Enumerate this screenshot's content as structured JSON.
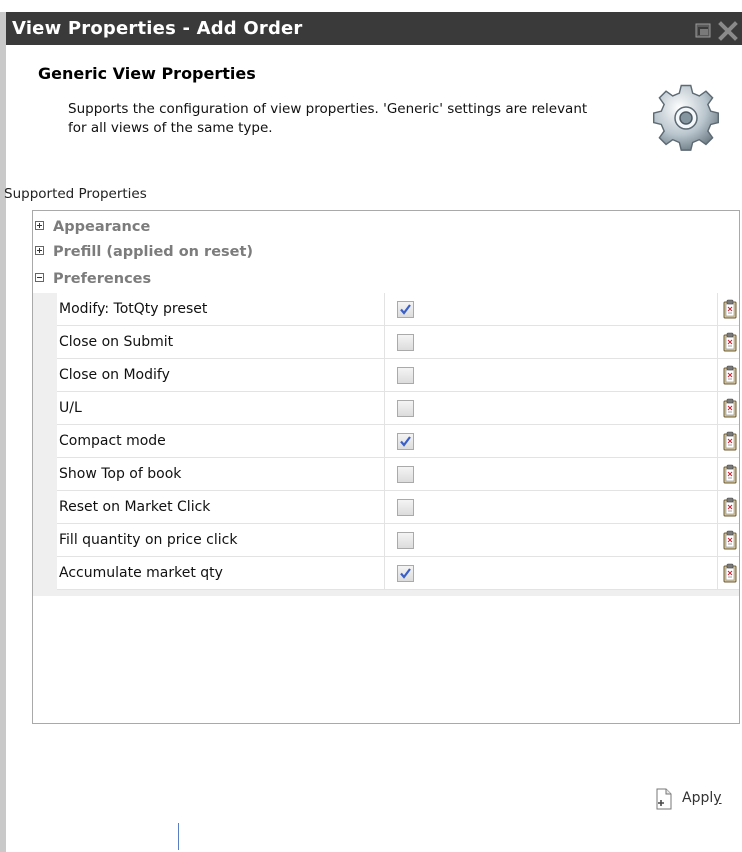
{
  "window": {
    "title": "View Properties - Add Order"
  },
  "header": {
    "title": "Generic View Properties",
    "description": "Supports the configuration of view properties. 'Generic' settings are relevant for all views of the same type."
  },
  "supported_label": "Supported Properties",
  "groups": [
    {
      "label": "Appearance",
      "expanded": false
    },
    {
      "label": "Prefill (applied on reset)",
      "expanded": false
    },
    {
      "label": "Preferences",
      "expanded": true
    }
  ],
  "preferences": [
    {
      "name": "Modify: TotQty preset",
      "checked": true
    },
    {
      "name": "Close on Submit",
      "checked": false
    },
    {
      "name": "Close on Modify",
      "checked": false
    },
    {
      "name": "U/L",
      "checked": false
    },
    {
      "name": "Compact mode",
      "checked": true
    },
    {
      "name": "Show Top of book",
      "checked": false
    },
    {
      "name": "Reset on Market Click",
      "checked": false
    },
    {
      "name": "Fill quantity on price click",
      "checked": false
    },
    {
      "name": "Accumulate market qty",
      "checked": true
    }
  ],
  "apply": {
    "label": "Apply",
    "mnemonic": "y"
  },
  "colors": {
    "titlebar": "#3a3a3a",
    "check": "#3a5fc8",
    "group_text": "#7c7c7c"
  }
}
